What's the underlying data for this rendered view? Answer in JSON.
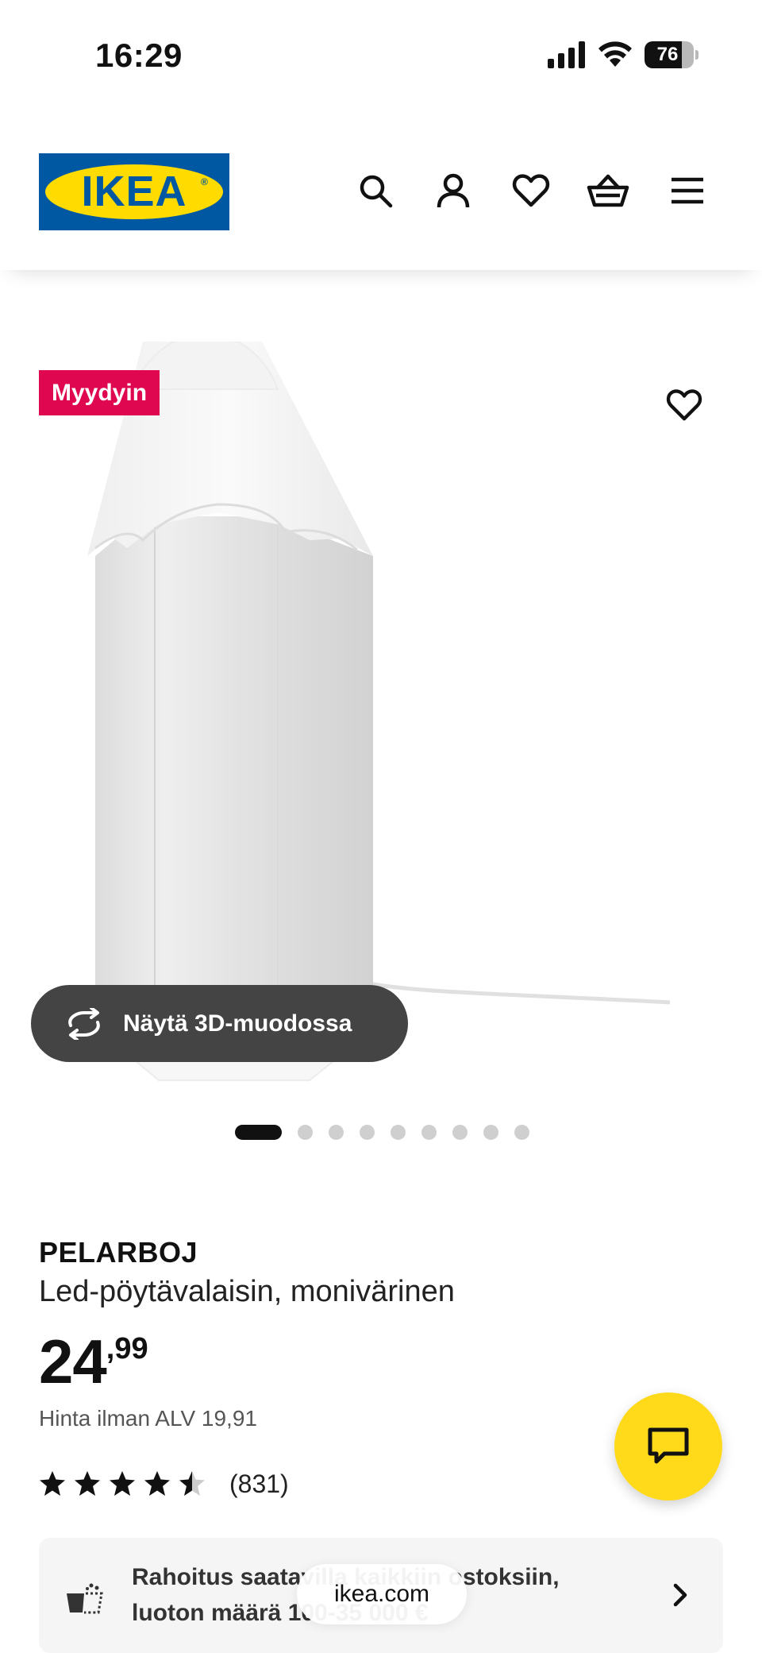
{
  "status_bar": {
    "time": "16:29",
    "battery_level": 76,
    "battery_text": "76"
  },
  "header": {
    "logo_text": "IKEA",
    "logo_mark": "®",
    "icons": [
      "search-icon",
      "account-icon",
      "favourites-icon",
      "cart-icon",
      "menu-icon"
    ]
  },
  "gallery": {
    "badge": "Myydyin",
    "view_3d_label": "Näytä 3D-muodossa",
    "slide_count": 9,
    "active_slide": 1
  },
  "product": {
    "name": "PELARBOJ",
    "description": "Led-pöytävalaisin, monivärinen",
    "price_int": "24",
    "price_dec": ",99",
    "price_net": "Hinta ilman ALV 19,91",
    "rating": 4.5,
    "rating_max": 5,
    "rating_count": "(831)"
  },
  "financing": {
    "text_line1": "Rahoitus saatavilla kaikkiin ostoksiin,",
    "text_line2": "luoton määrä 100-35 000 €"
  },
  "browser": {
    "url": "ikea.com"
  },
  "colors": {
    "ikea_blue": "#0058a3",
    "ikea_yellow": "#ffdb00",
    "badge_red": "#e00751",
    "chat_yellow": "#ffda1a",
    "pill_dark": "#444444"
  }
}
